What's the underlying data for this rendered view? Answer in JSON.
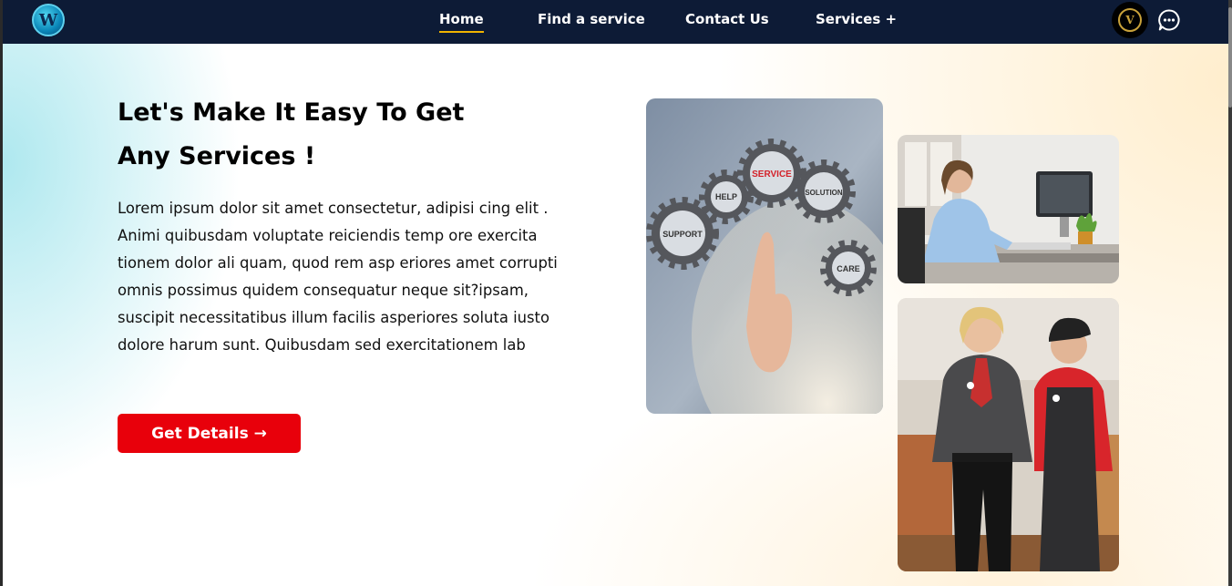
{
  "nav": {
    "logo_letter": "W",
    "links": [
      {
        "label": "Home",
        "active": true
      },
      {
        "label": "Find a service",
        "active": false
      },
      {
        "label": "Contact Us",
        "active": false
      },
      {
        "label": "Services +",
        "active": false
      }
    ],
    "badge_letter": "V",
    "icons": {
      "badge": "crown-badge-icon",
      "chat": "chat-bubble-icon"
    },
    "active_underline_color": "#f0b400",
    "background_color": "#0d1b36"
  },
  "hero": {
    "headline": "Let's Make It Easy To Get Any Services !",
    "body": "Lorem ipsum dolor sit amet consectetur, adipisi cing elit . Animi quibusdam voluptate reiciendis temp ore exercita tionem dolor ali quam, quod rem asp eriores amet corrupti omnis possimus quidem consequatur neque sit?ipsam, suscipit necessitatibus illum facilis asperiores soluta iusto dolore harum sunt. Quibusdam sed exercitationem lab",
    "cta_label": "Get Details →",
    "cta_color": "#e8000b"
  },
  "gallery": {
    "gear_labels": [
      "SUPPORT",
      "HELP",
      "SERVICE",
      "SOLUTION",
      "CARE"
    ]
  }
}
